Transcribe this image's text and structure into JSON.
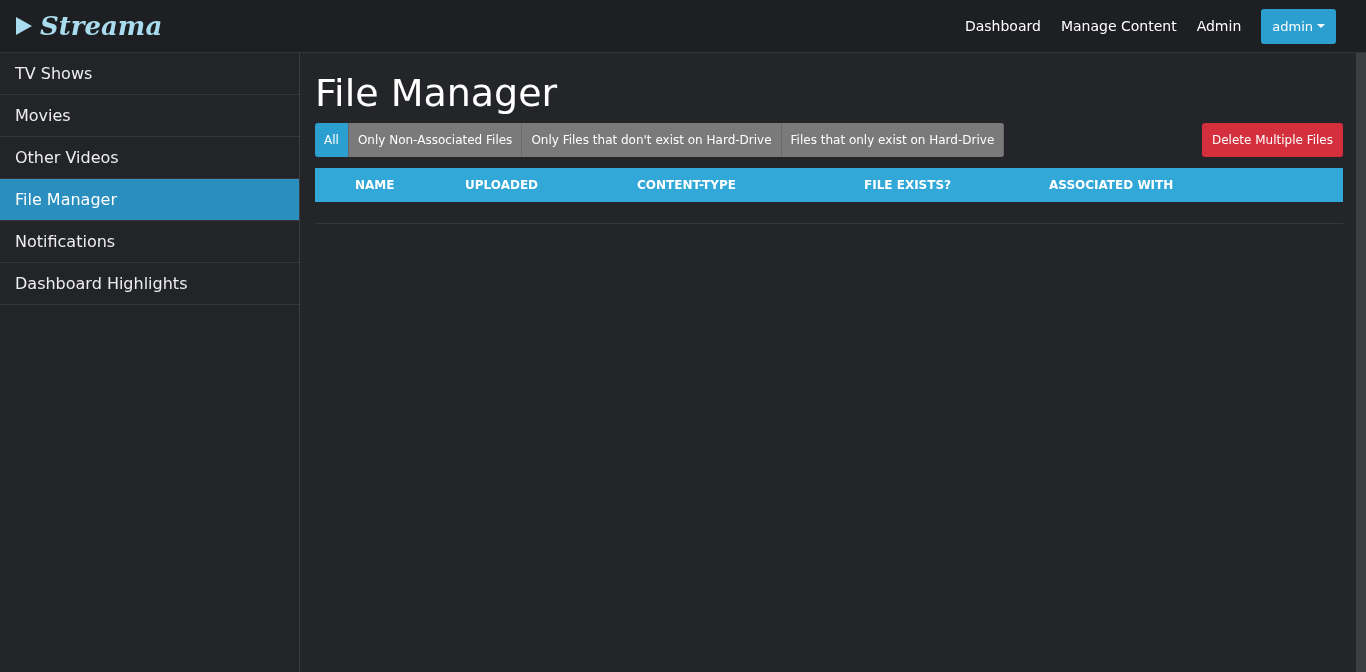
{
  "brand": {
    "name": "Streama"
  },
  "nav": {
    "links": [
      "Dashboard",
      "Manage Content",
      "Admin"
    ],
    "user_menu": "admin"
  },
  "sidebar": {
    "items": [
      {
        "label": "TV Shows",
        "selected": false
      },
      {
        "label": "Movies",
        "selected": false
      },
      {
        "label": "Other Videos",
        "selected": false
      },
      {
        "label": "File Manager",
        "selected": true
      },
      {
        "label": "Notifications",
        "selected": false
      },
      {
        "label": "Dashboard Highlights",
        "selected": false
      }
    ]
  },
  "page_title": "File Manager",
  "filters": [
    {
      "label": "All",
      "selected": true
    },
    {
      "label": "Only Non-Associated Files",
      "selected": false
    },
    {
      "label": "Only Files that don't exist on Hard-Drive",
      "selected": false
    },
    {
      "label": "Files that only exist on Hard-Drive",
      "selected": false
    }
  ],
  "delete_button": "Delete Multiple Files",
  "table": {
    "columns": [
      "NAME",
      "UPLOADED",
      "CONTENT-TYPE",
      "FILE EXISTS?",
      "ASSOCIATED WITH"
    ]
  }
}
